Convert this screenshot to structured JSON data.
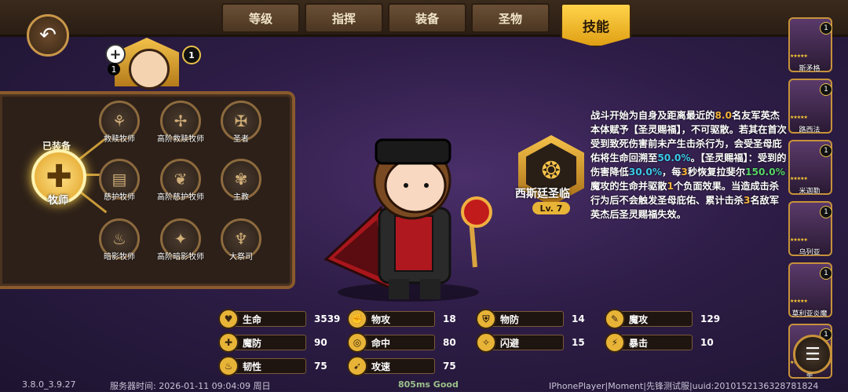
{
  "tabs": [
    {
      "label": "等级"
    },
    {
      "label": "指挥"
    },
    {
      "label": "装备"
    },
    {
      "label": "圣物"
    },
    {
      "label": "技能"
    }
  ],
  "hero_top": {
    "plus_badge": "+",
    "level_badge": "1",
    "small_badge": "1"
  },
  "skill_tree": {
    "equipped_label": "已装备",
    "equipped_name": "牧师",
    "nodes": [
      {
        "label": "救赎牧师"
      },
      {
        "label": "高阶救赎牧师"
      },
      {
        "label": "圣者"
      },
      {
        "label": "慈护牧师"
      },
      {
        "label": "高阶慈护牧师"
      },
      {
        "label": "主教"
      },
      {
        "label": "暗影牧师"
      },
      {
        "label": "高阶暗影牧师"
      },
      {
        "label": "大祭司"
      }
    ]
  },
  "skill": {
    "name": "西斯廷圣临",
    "level": "Lv. 7",
    "description": [
      {
        "t": "战斗开始为自身及距离最近的",
        "c": ""
      },
      {
        "t": "8.0",
        "c": "y"
      },
      {
        "t": "名友军英杰本体赋予【圣灵赐福】，不可驱散。若其在首次受到致死伤害前未产生击杀行为，会受圣母庇佑将生命回溯至",
        "c": ""
      },
      {
        "t": "50.0%",
        "c": "c"
      },
      {
        "t": "。【圣灵赐福】：受到的伤害降低",
        "c": ""
      },
      {
        "t": "30.0%",
        "c": "c"
      },
      {
        "t": "，每",
        "c": ""
      },
      {
        "t": "3",
        "c": "y"
      },
      {
        "t": "秒恢复拉斐尔",
        "c": ""
      },
      {
        "t": "150.0%",
        "c": "g"
      },
      {
        "t": "魔攻的生命并驱散",
        "c": ""
      },
      {
        "t": "1",
        "c": "y"
      },
      {
        "t": "个负面效果。当造成击杀行为后不会触发圣母庇佑、累计击杀",
        "c": ""
      },
      {
        "t": "3",
        "c": "y"
      },
      {
        "t": "名敌军英杰后圣灵赐福失效。",
        "c": ""
      }
    ]
  },
  "roster": [
    {
      "name": "斯矛格",
      "badge": "1"
    },
    {
      "name": "路西法",
      "badge": "1"
    },
    {
      "name": "米迦勒",
      "badge": "1"
    },
    {
      "name": "乌列亚",
      "badge": "1"
    },
    {
      "name": "莫利亚炎魔",
      "badge": "1"
    },
    {
      "name": "墨",
      "badge": "1"
    }
  ],
  "stats": [
    {
      "label": "生命",
      "value": "3539"
    },
    {
      "label": "物攻",
      "value": "18"
    },
    {
      "label": "物防",
      "value": "14"
    },
    {
      "label": "魔攻",
      "value": "129"
    },
    {
      "label": "魔防",
      "value": "90"
    },
    {
      "label": "命中",
      "value": "80"
    },
    {
      "label": "闪避",
      "value": "15"
    },
    {
      "label": "暴击",
      "value": "10"
    },
    {
      "label": "韧性",
      "value": "75"
    },
    {
      "label": "攻速",
      "value": "75"
    }
  ],
  "footer": {
    "version": "3.8.0_3.9.27",
    "server_time": "服务器时间:  2026-01-11  09:04:09  周日",
    "ping": "805ms Good",
    "device": "IPhonePlayer|Moment|先锋测试服|uuid:2010152136328781824"
  },
  "icons": {
    "back": "back-arrow-icon",
    "menu": "menu-icon"
  }
}
